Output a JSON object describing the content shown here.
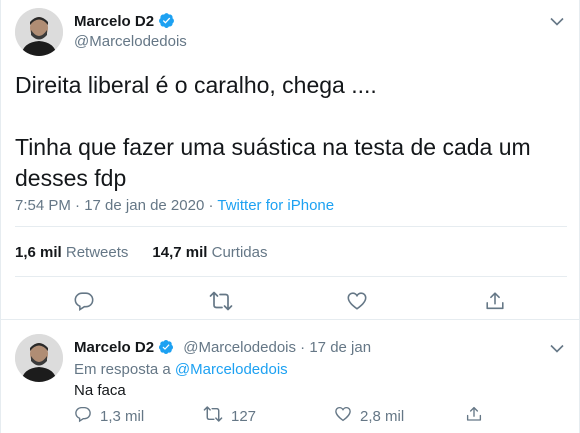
{
  "tweet": {
    "author_name": "Marcelo D2",
    "author_handle": "@Marcelodedois",
    "text": "Direita liberal é o caralho, chega ....\n\nTinha que fazer uma suástica na testa de cada um desses fdp",
    "timestamp": "7:54 PM · 17 de jan de 2020 · ",
    "source": "Twitter for iPhone",
    "retweets_count": "1,6 mil",
    "retweets_label": "Retweets",
    "likes_count": "14,7 mil",
    "likes_label": "Curtidas",
    "icons": [
      "verified-icon",
      "chevron-down-icon",
      "reply-icon",
      "retweet-icon",
      "like-icon",
      "share-icon"
    ]
  },
  "reply": {
    "author_name": "Marcelo D2",
    "author_handle": "@Marcelodedois",
    "separator": " · ",
    "date": "17 de jan",
    "in_reply_prefix": "Em resposta a ",
    "in_reply_mention": "@Marcelodedois",
    "text": "Na faca",
    "reply_count": "1,3 mil",
    "retweet_count": "127",
    "like_count": "2,8 mil"
  },
  "colors": {
    "accent": "#1da1f2",
    "secondary_text": "#657786",
    "primary_text": "#14171a",
    "border": "#e6ecf0"
  }
}
